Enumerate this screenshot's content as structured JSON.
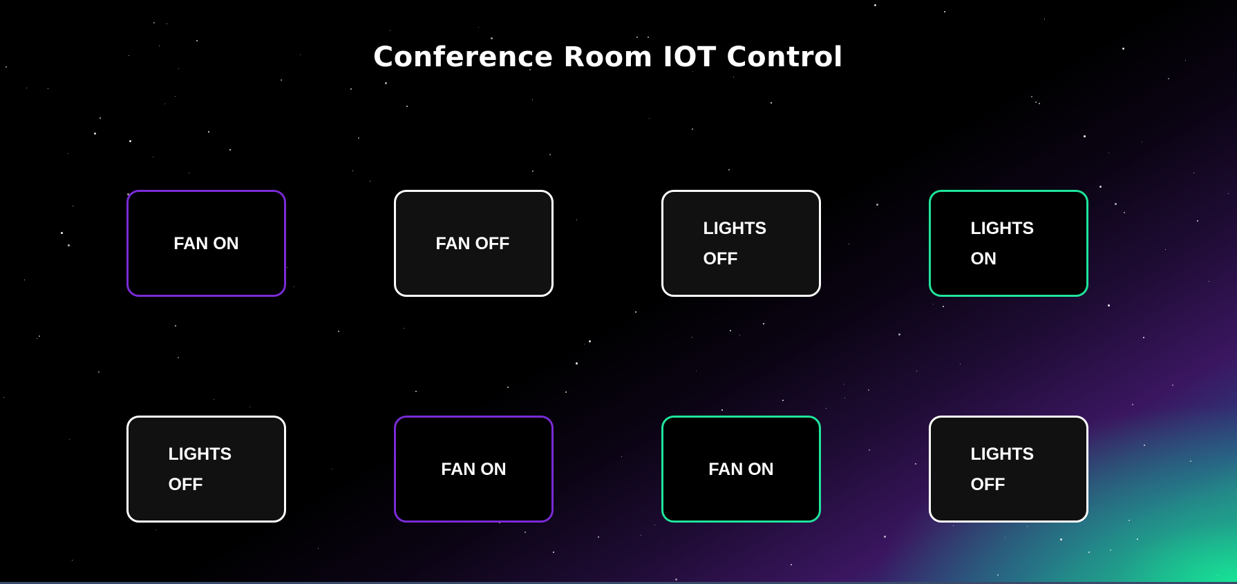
{
  "page": {
    "title": "Conference Room IOT Control"
  },
  "tiles": [
    {
      "label": "FAN ON",
      "state": "on",
      "accent": "#7a2bd6"
    },
    {
      "label": "FAN OFF",
      "state": "off",
      "accent": "#ffffff"
    },
    {
      "label": "LIGHTS OFF",
      "state": "off",
      "accent": "#ffffff"
    },
    {
      "label": "LIGHTS ON",
      "state": "on",
      "accent": "#1fe59c"
    },
    {
      "label": "LIGHTS OFF",
      "state": "off",
      "accent": "#ffffff"
    },
    {
      "label": "FAN ON",
      "state": "on",
      "accent": "#7a2bd6"
    },
    {
      "label": "FAN ON",
      "state": "on",
      "accent": "#1fe59c"
    },
    {
      "label": "LIGHTS OFF",
      "state": "off",
      "accent": "#ffffff"
    }
  ],
  "colors": {
    "background": "#000000",
    "purple_accent": "#7a2bd6",
    "green_accent": "#1fe59c",
    "off_border": "#ffffff",
    "off_fill": "#111111"
  }
}
